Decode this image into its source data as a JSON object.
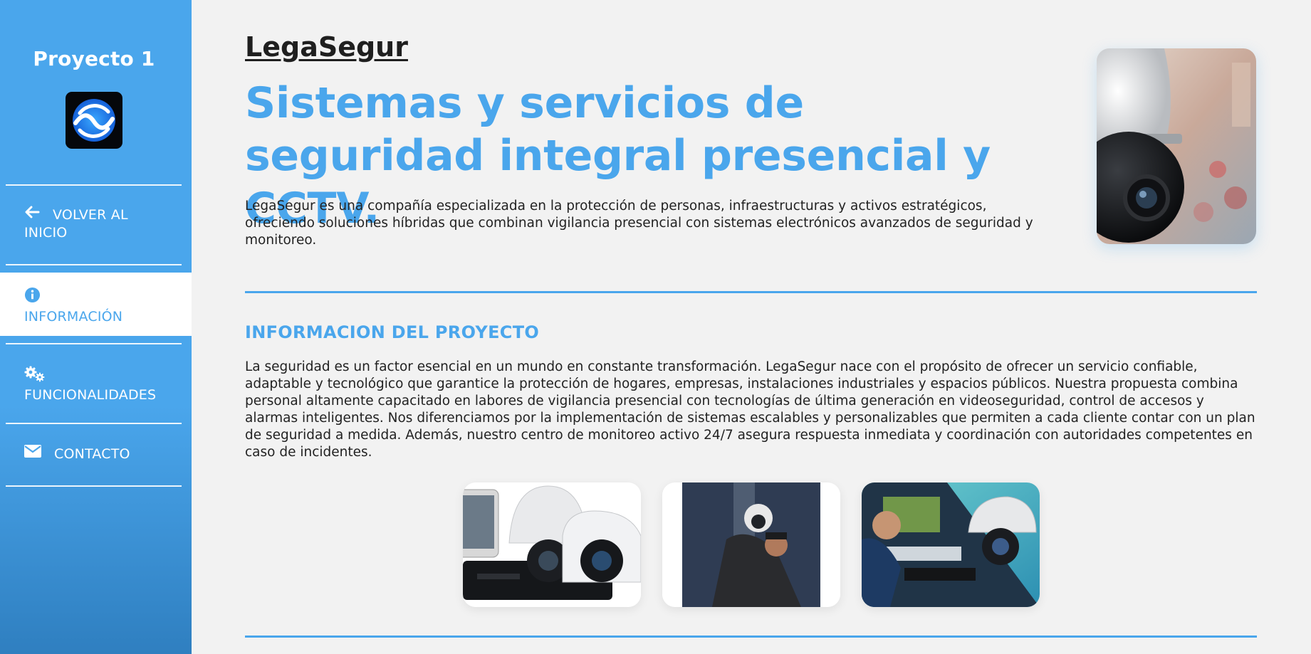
{
  "sidebar": {
    "title": "Proyecto 1",
    "logo_icon": "app-logo-wave",
    "items": [
      {
        "id": "back",
        "label": "VOLVER AL INICIO",
        "icon": "arrow-left-icon",
        "active": false
      },
      {
        "id": "info",
        "label": "INFORMACIÓN",
        "icon": "info-circle-icon",
        "active": true
      },
      {
        "id": "features",
        "label": "FUNCIONALIDADES",
        "icon": "gears-icon",
        "active": false
      },
      {
        "id": "contact",
        "label": "CONTACTO",
        "icon": "envelope-icon",
        "active": false
      }
    ]
  },
  "main": {
    "brand": "LegaSegur",
    "headline": "Sistemas y servicios de seguridad integral presencial y CCTV.",
    "intro": "LegaSegur es una compañía especializada en la protección de personas, infraestructuras y activos estratégicos, ofreciendo soluciones híbridas que combinan vigilancia presencial con sistemas electrónicos avanzados de seguridad y monitoreo.",
    "section_title": "INFORMACION DEL PROYECTO",
    "section_body": "La seguridad es un factor esencial en un mundo en constante transformación. LegaSegur nace con el propósito de ofrecer un servicio confiable, adaptable y tecnológico que garantice la protección de hogares, empresas, instalaciones industriales y espacios públicos. Nuestra propuesta combina personal altamente capacitado en labores de vigilancia presencial con tecnologías de última generación en videoseguridad, control de accesos y alarmas inteligentes. Nos diferenciamos por la implementación de sistemas escalables y personalizables que permiten a cada cliente contar con un plan de seguridad a medida. Además, nuestro centro de monitoreo activo 24/7 asegura respuesta inmediata y coordinación con autoridades competentes en caso de incidentes."
  },
  "colors": {
    "accent": "#4aa6ec",
    "sidebar_dark": "#2f7fc0",
    "background": "#f2f2f2",
    "text": "#222222"
  }
}
